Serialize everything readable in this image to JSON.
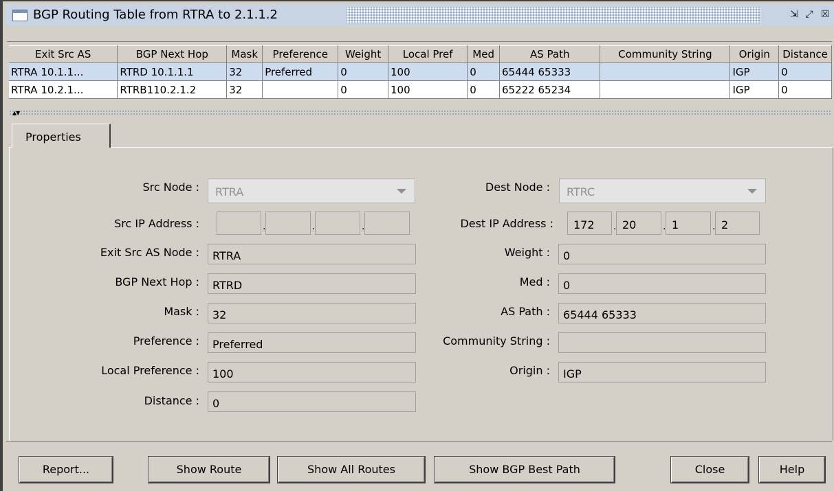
{
  "window": {
    "title": "BGP Routing Table from RTRA to 2.1.1.2",
    "buttons": {
      "minimize": "⇲",
      "maximize": "⤢",
      "close": "☒"
    }
  },
  "table": {
    "columns": [
      "Exit Src AS",
      "BGP Next Hop",
      "Mask",
      "Preference",
      "Weight",
      "Local Pref",
      "Med",
      "AS Path",
      "Community String",
      "Origin",
      "Distance"
    ],
    "rows": [
      [
        "RTRA 10.1.1...",
        "RTRD 10.1.1.1",
        "32",
        "Preferred",
        "0",
        "100",
        "0",
        "65444 65333",
        "",
        "IGP",
        "0"
      ],
      [
        "RTRA 10.2.1...",
        "RTRB110.2.1.2",
        "32",
        "",
        "0",
        "100",
        "0",
        "65222 65234",
        "",
        "IGP",
        "0"
      ]
    ]
  },
  "tabs": {
    "properties": "Properties"
  },
  "form": {
    "src_node_label": "Src Node :",
    "src_node_value": "RTRA",
    "dest_node_label": "Dest Node :",
    "dest_node_value": "RTRC",
    "src_ip_label": "Src IP Address :",
    "src_ip": [
      "",
      "",
      "",
      ""
    ],
    "dest_ip_label": "Dest IP Address :",
    "dest_ip": [
      "172",
      "20",
      "1",
      "2"
    ],
    "exit_src_as_node_label": "Exit Src AS Node :",
    "exit_src_as_node": "RTRA",
    "weight_label": "Weight :",
    "weight": "0",
    "bgp_next_hop_label": "BGP Next Hop :",
    "bgp_next_hop": "RTRD",
    "med_label": "Med :",
    "med": "0",
    "mask_label": "Mask :",
    "mask": "32",
    "as_path_label": "AS Path :",
    "as_path": "65444 65333",
    "preference_label": "Preference :",
    "preference": "Preferred",
    "community_label": "Community String :",
    "community": "",
    "local_pref_label": "Local Preference :",
    "local_pref": "100",
    "origin_label": "Origin :",
    "origin": "IGP",
    "distance_label": "Distance :",
    "distance": "0"
  },
  "buttons": {
    "report": "Report...",
    "show_route": "Show Route",
    "show_all_routes": "Show All Routes",
    "show_bgp_best_path": "Show BGP Best Path",
    "close": "Close",
    "help": "Help"
  }
}
